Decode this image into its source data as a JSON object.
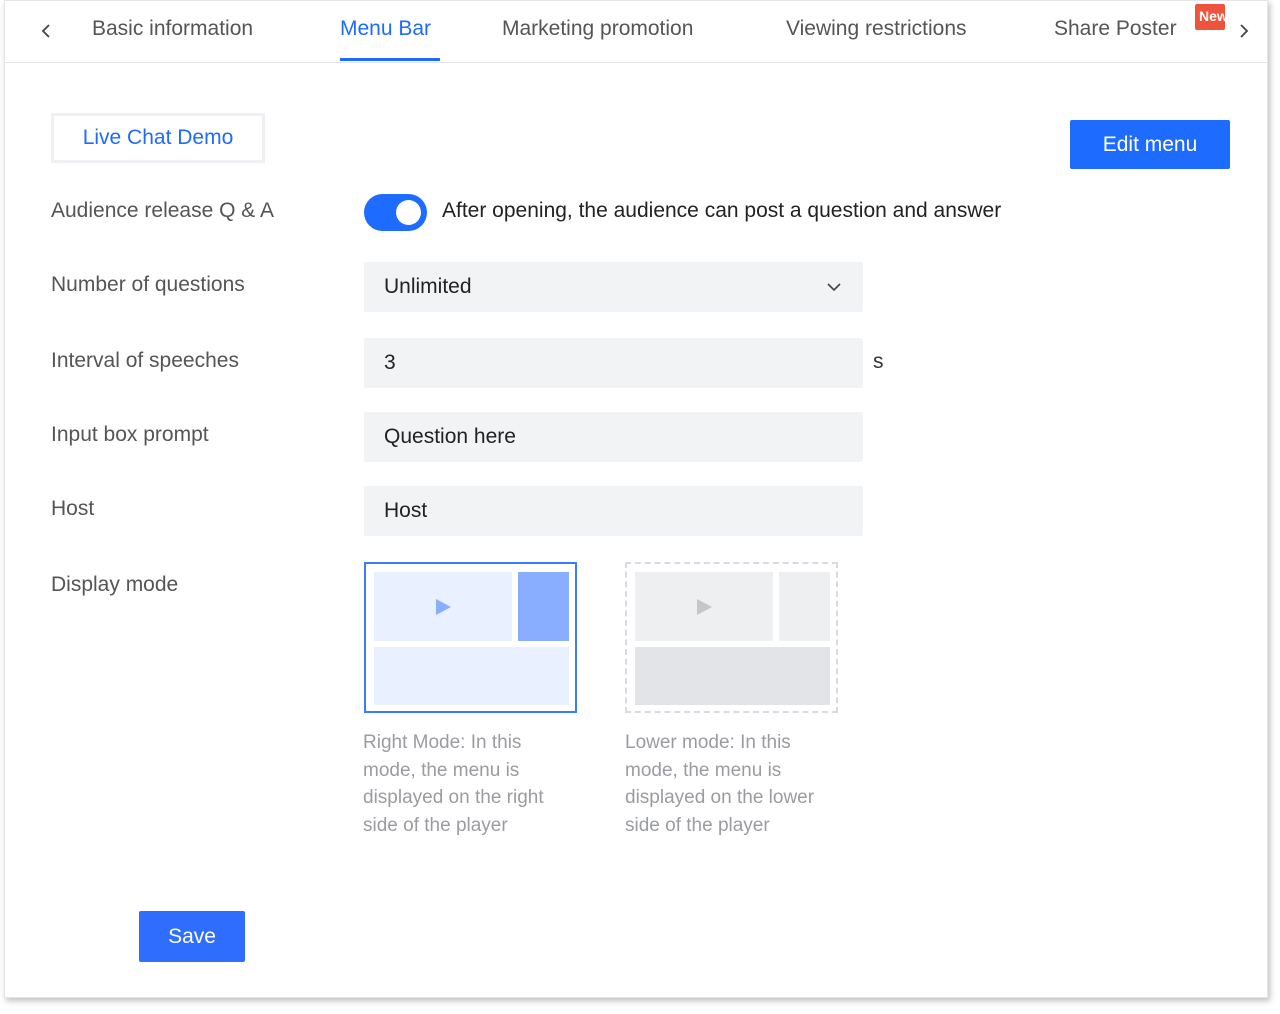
{
  "tabs": [
    {
      "label": "Basic information",
      "active": false
    },
    {
      "label": "Menu Bar",
      "active": true
    },
    {
      "label": "Marketing promotion",
      "active": false
    },
    {
      "label": "Viewing restrictions",
      "active": false
    },
    {
      "label": "Share Poster",
      "active": false,
      "badge": "New"
    }
  ],
  "icons": {
    "prev": "chevron-left-icon",
    "next": "chevron-right-icon",
    "dropdown": "chevron-down-icon",
    "play": "play-icon"
  },
  "demo_chip": "Live Chat Demo",
  "edit_menu_label": "Edit menu",
  "form": {
    "qa": {
      "label": "Audience release Q & A",
      "enabled": true,
      "description": "After opening, the audience can post a question and answer"
    },
    "num_questions": {
      "label": "Number of questions",
      "value": "Unlimited"
    },
    "interval": {
      "label": "Interval of speeches",
      "value": "3",
      "unit": "s"
    },
    "prompt": {
      "label": "Input box prompt",
      "value": "Question here"
    },
    "host": {
      "label": "Host",
      "value": "Host"
    },
    "display_mode": {
      "label": "Display mode",
      "selected": "right",
      "options": [
        {
          "id": "right",
          "description": "Right Mode: In this mode, the menu is displayed on the right side of the player"
        },
        {
          "id": "lower",
          "description": "Lower mode: In this mode, the menu is displayed on the lower side of the player"
        }
      ]
    }
  },
  "save_label": "Save",
  "colors": {
    "accent": "#1e6bff",
    "badge": "#f0533c",
    "field_bg": "#f2f3f5",
    "selected_menu_block": "#8aaeff"
  }
}
